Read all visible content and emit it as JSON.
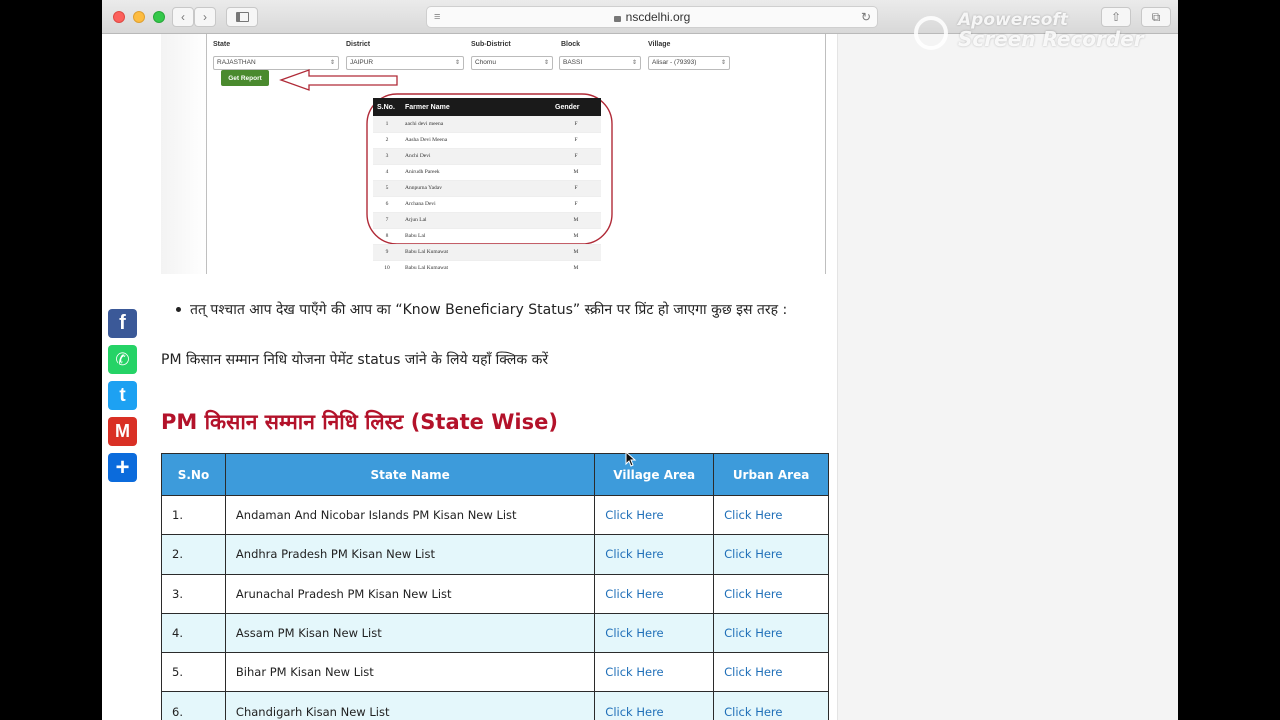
{
  "browser": {
    "url": "nscdelhi.org"
  },
  "watermark": {
    "line1": "Apowersoft",
    "line2": "Screen Recorder"
  },
  "embedded_screenshot": {
    "filters": [
      {
        "label": "State",
        "value": "RAJASTHAN"
      },
      {
        "label": "District",
        "value": "JAIPUR"
      },
      {
        "label": "Sub-District",
        "value": "Chomu"
      },
      {
        "label": "Block",
        "value": "BASSI"
      },
      {
        "label": "Village",
        "value": "Alisar - (79393)"
      }
    ],
    "button": "Get Report",
    "table_headers": [
      "S.No.",
      "Farmer Name",
      "Gender"
    ],
    "rows": [
      [
        "1",
        "aachi devi meena",
        "F"
      ],
      [
        "2",
        "Aasha Devi Meena",
        "F"
      ],
      [
        "3",
        "Anchi Devi",
        "F"
      ],
      [
        "4",
        "Anirudh Pareek",
        "M"
      ],
      [
        "5",
        "Annpurna Yadav",
        "F"
      ],
      [
        "6",
        "Archana Devi",
        "F"
      ],
      [
        "7",
        "Arjun Lal",
        "M"
      ],
      [
        "8",
        "Babu Lal",
        "M"
      ],
      [
        "9",
        "Babu Lal Kumawat",
        "M"
      ],
      [
        "10",
        "Babu Lal Kumawat",
        "M"
      ]
    ]
  },
  "bullet_text": "तत् पश्चात आप देख पाएँगे की आप का “Know Beneficiary Status” स्क्रीन पर प्रिंट हो जाएगा कुछ इस तरह :",
  "paragraph": "PM किसान सम्मान निधि योजना पेमेंट status जांने के लिये यहाँ क्लिक करें",
  "heading": "PM किसान सम्मान निधि लिस्ट (State Wise)",
  "state_table": {
    "headers": [
      "S.No",
      "State Name",
      "Village Area",
      "Urban Area"
    ],
    "rows": [
      {
        "sno": "1.",
        "name": "Andaman And Nicobar Islands PM Kisan New List",
        "village": "Click Here",
        "urban": "Click Here"
      },
      {
        "sno": "2.",
        "name": "Andhra Pradesh PM Kisan New List",
        "village": "Click Here",
        "urban": "Click Here"
      },
      {
        "sno": "3.",
        "name": "Arunachal Pradesh PM Kisan New List",
        "village": "Click Here",
        "urban": "Click Here"
      },
      {
        "sno": "4.",
        "name": "Assam PM Kisan New List",
        "village": "Click Here",
        "urban": "Click Here"
      },
      {
        "sno": "5.",
        "name": "Bihar PM Kisan New List",
        "village": "Click Here",
        "urban": "Click Here"
      },
      {
        "sno": "6.",
        "name": "Chandigarh Kisan New List",
        "village": "Click Here",
        "urban": "Click Here"
      }
    ]
  },
  "share_buttons": [
    {
      "name": "facebook",
      "color": "#3b5998",
      "glyph": "f"
    },
    {
      "name": "whatsapp",
      "color": "#25d366",
      "glyph": "✆"
    },
    {
      "name": "twitter",
      "color": "#1da1f2",
      "glyph": "t"
    },
    {
      "name": "gmail",
      "color": "#d93025",
      "glyph": "M"
    },
    {
      "name": "share",
      "color": "#0b6bdc",
      "glyph": "+"
    }
  ],
  "colors": {
    "heading": "#b3122a",
    "table_header": "#3d9bdb",
    "row_alt": "#e4f7fb",
    "link": "#1f6fb8"
  }
}
